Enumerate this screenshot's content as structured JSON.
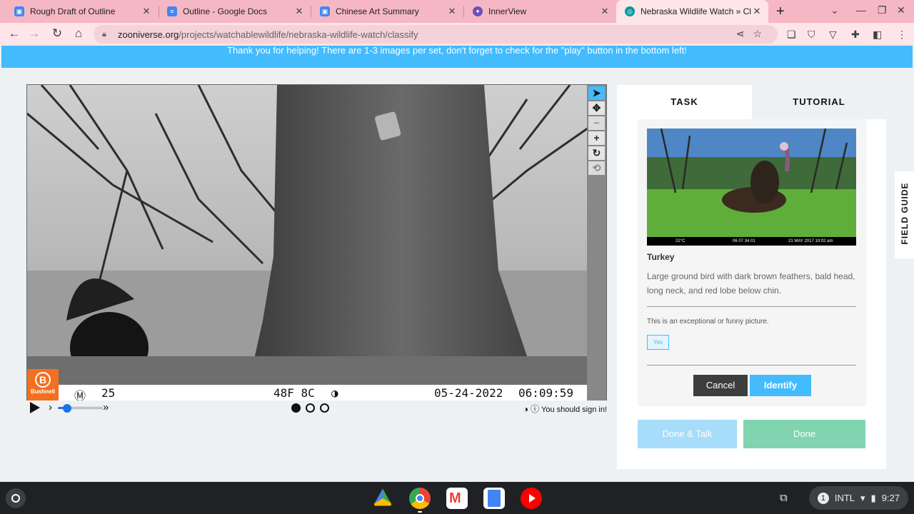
{
  "browser": {
    "tabs": [
      {
        "title": "Rough Draft of Outline",
        "favicon_color": "#4285f4",
        "active": false
      },
      {
        "title": "Outline - Google Docs",
        "favicon_color": "#4285f4",
        "active": false
      },
      {
        "title": "Chinese Art Summary",
        "favicon_color": "#4285f4",
        "active": false
      },
      {
        "title": "InnerView",
        "favicon_color": "#6b4fbb",
        "active": false
      },
      {
        "title": "Nebraska Wildlife Watch » Cla",
        "favicon_color": "#00979d",
        "active": true
      }
    ],
    "url_host": "zooniverse.org",
    "url_path": "/projects/watchablewildlife/nebraska-wildlife-watch/classify"
  },
  "banner": {
    "text": "Thank you for helping! There are 1-3 images per set, don't forget to check for the \"play\" button in the bottom left!"
  },
  "viewer": {
    "camera_strip": {
      "moon_icon": "Ⓜ",
      "sequence": "25",
      "temp": "48F 8C",
      "date": "05-24-2022",
      "time": "06:09:59"
    },
    "brand_logo": "Bushnell",
    "tools": [
      "pointer-icon",
      "move-icon",
      "zoom-out-icon",
      "zoom-in-icon",
      "rotate-icon",
      "reset-icon"
    ],
    "frame_count": 3,
    "current_frame": 1,
    "playback_position": 0.2,
    "signin_text": "You should sign in!"
  },
  "task_panel": {
    "tab_task": "TASK",
    "tab_tutorial": "TUTORIAL",
    "thumb_strip": {
      "temp": "22°C",
      "code": "06 07 34 01",
      "date": "21 MAY 2017  10:02 am"
    },
    "critter_name": "Turkey",
    "critter_description": "Large ground bird with dark brown feathers, bald head, long neck, and red lobe below chin.",
    "question": "This is an exceptional or funny picture.",
    "yes_label": "Yes",
    "cancel_label": "Cancel",
    "identify_label": "Identify",
    "done_talk_label": "Done & Talk",
    "done_label": "Done"
  },
  "field_guide_label": "FIELD GUIDE",
  "shelf": {
    "apps": [
      "drive-icon",
      "chrome-icon",
      "gmail-icon",
      "docs-icon",
      "youtube-icon"
    ],
    "status": {
      "notification_count": "1",
      "ime": "INTL",
      "time": "9:27"
    }
  },
  "colors": {
    "accent": "#43bbfd",
    "done": "#80d4b0",
    "tabbar": "#f6b7c4"
  }
}
